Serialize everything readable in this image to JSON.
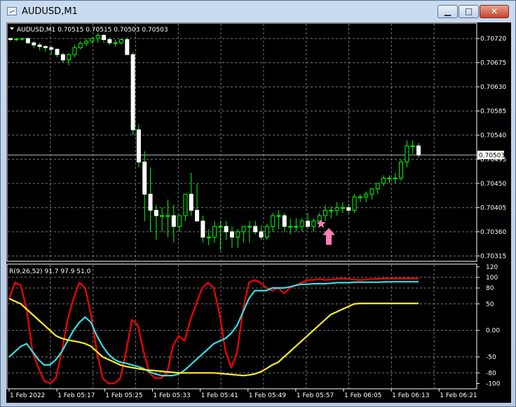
{
  "window": {
    "title": "AUDUSD,M1",
    "minimize": "▁",
    "maximize": "□",
    "close": "✕"
  },
  "chart": {
    "header": "AUDUSD,M1  0.70515 0.70515 0.70503 0.70503",
    "current_price": "0.70503",
    "price_ticks": [
      "0.70720",
      "0.70675",
      "0.70630",
      "0.70585",
      "0.70540",
      "0.70495",
      "0.70450",
      "0.70405",
      "0.70360",
      "0.70315"
    ],
    "time_ticks": [
      "1 Feb 2022",
      "1 Feb 05:17",
      "1 Feb 05:25",
      "1 Feb 05:33",
      "1 Feb 05:41",
      "1 Feb 05:49",
      "1 Feb 05:57",
      "1 Feb 06:05",
      "1 Feb 06:13",
      "1 Feb 06:21"
    ]
  },
  "indicator": {
    "label": "R(9,26,52) 91.7 97.9 51.0",
    "ticks": [
      "120",
      "100",
      "80",
      "50",
      "0.00",
      "-50",
      "-80",
      "-100"
    ]
  },
  "colors": {
    "bull": "#00ff00",
    "bear": "#ffffff",
    "red": "#ff0000",
    "cyan": "#33e0e8",
    "yellow": "#ffee22",
    "grid": "#777777",
    "arrow": "#ff7fb6"
  },
  "chart_data": [
    {
      "type": "candlestick",
      "title": "AUDUSD,M1",
      "x": [
        "05:09",
        "05:10",
        "05:11",
        "05:12",
        "05:13",
        "05:14",
        "05:15",
        "05:16",
        "05:17",
        "05:18",
        "05:19",
        "05:20",
        "05:21",
        "05:22",
        "05:23",
        "05:24",
        "05:25",
        "05:26",
        "05:27",
        "05:28",
        "05:29",
        "05:30",
        "05:31",
        "05:32",
        "05:33",
        "05:34",
        "05:35",
        "05:36",
        "05:37",
        "05:38",
        "05:39",
        "05:40",
        "05:41",
        "05:42",
        "05:43",
        "05:44",
        "05:45",
        "05:46",
        "05:47",
        "05:48",
        "05:49",
        "05:50",
        "05:51",
        "05:52",
        "05:53",
        "05:54",
        "05:55",
        "05:56",
        "05:57",
        "05:58",
        "05:59",
        "06:00",
        "06:01",
        "06:02",
        "06:03",
        "06:04",
        "06:05",
        "06:06",
        "06:07",
        "06:08",
        "06:09",
        "06:10",
        "06:11",
        "06:12",
        "06:13",
        "06:14",
        "06:15",
        "06:16",
        "06:17",
        "06:18",
        "06:19"
      ],
      "open": [
        0.7072,
        0.70718,
        0.70719,
        0.7072,
        0.70712,
        0.70708,
        0.70705,
        0.70703,
        0.707,
        0.7069,
        0.7068,
        0.7069,
        0.70703,
        0.70711,
        0.70715,
        0.7072,
        0.70726,
        0.70718,
        0.70712,
        0.70712,
        0.70718,
        0.7069,
        0.7055,
        0.7049,
        0.7043,
        0.704,
        0.7039,
        0.7039,
        0.7039,
        0.7037,
        0.7039,
        0.7043,
        0.704,
        0.7038,
        0.7035,
        0.7035,
        0.7037,
        0.7037,
        0.7036,
        0.7035,
        0.7036,
        0.7037,
        0.7037,
        0.7036,
        0.7035,
        0.7037,
        0.7039,
        0.7039,
        0.7037,
        0.7037,
        0.7037,
        0.7038,
        0.7037,
        0.7038,
        0.7039,
        0.704,
        0.704,
        0.70405,
        0.70405,
        0.704,
        0.70425,
        0.70425,
        0.7043,
        0.7044,
        0.7045,
        0.7046,
        0.7046,
        0.7046,
        0.7049,
        0.7052,
        0.7052
      ],
      "high": [
        0.70722,
        0.70721,
        0.70721,
        0.70722,
        0.70715,
        0.70712,
        0.70708,
        0.70706,
        0.70702,
        0.70694,
        0.70692,
        0.70708,
        0.70715,
        0.7072,
        0.70722,
        0.7073,
        0.70728,
        0.70722,
        0.70718,
        0.7072,
        0.70722,
        0.70695,
        0.7056,
        0.7051,
        0.7048,
        0.7041,
        0.70405,
        0.7042,
        0.7041,
        0.7039,
        0.7042,
        0.7047,
        0.7045,
        0.7039,
        0.70365,
        0.7038,
        0.7038,
        0.7038,
        0.7037,
        0.70365,
        0.7037,
        0.7038,
        0.7038,
        0.70372,
        0.70375,
        0.70395,
        0.704,
        0.70395,
        0.70385,
        0.70385,
        0.70385,
        0.70395,
        0.70385,
        0.70395,
        0.7041,
        0.70408,
        0.70415,
        0.70415,
        0.70412,
        0.7043,
        0.7043,
        0.70435,
        0.7044,
        0.7045,
        0.70465,
        0.70465,
        0.7047,
        0.70495,
        0.7053,
        0.7053,
        0.70525
      ],
      "low": [
        0.70715,
        0.70715,
        0.70716,
        0.7071,
        0.70702,
        0.70698,
        0.70695,
        0.7069,
        0.70685,
        0.70675,
        0.7067,
        0.70685,
        0.707,
        0.70705,
        0.7071,
        0.70712,
        0.70712,
        0.70708,
        0.70705,
        0.70708,
        0.7069,
        0.7054,
        0.7048,
        0.7038,
        0.7036,
        0.70345,
        0.7036,
        0.7035,
        0.7034,
        0.7036,
        0.7038,
        0.7039,
        0.7038,
        0.7034,
        0.70335,
        0.7034,
        0.70325,
        0.70345,
        0.7033,
        0.7033,
        0.7034,
        0.7034,
        0.70355,
        0.70345,
        0.70345,
        0.7036,
        0.70365,
        0.7036,
        0.70355,
        0.7036,
        0.7036,
        0.70365,
        0.7036,
        0.7037,
        0.7038,
        0.70385,
        0.7039,
        0.70395,
        0.70395,
        0.70395,
        0.70415,
        0.70415,
        0.7042,
        0.7043,
        0.70445,
        0.7045,
        0.7045,
        0.70455,
        0.7048,
        0.70505,
        0.70498
      ],
      "close": [
        0.70718,
        0.70719,
        0.7072,
        0.70712,
        0.70708,
        0.70705,
        0.70703,
        0.707,
        0.7069,
        0.7068,
        0.7069,
        0.70703,
        0.70711,
        0.70715,
        0.7072,
        0.70726,
        0.70718,
        0.70712,
        0.70712,
        0.70718,
        0.7069,
        0.7055,
        0.7049,
        0.7043,
        0.704,
        0.7039,
        0.7039,
        0.7039,
        0.7037,
        0.7039,
        0.7043,
        0.704,
        0.7038,
        0.7035,
        0.7035,
        0.7037,
        0.7037,
        0.7036,
        0.7035,
        0.7036,
        0.7037,
        0.7037,
        0.7036,
        0.7035,
        0.7037,
        0.7039,
        0.7039,
        0.7037,
        0.7037,
        0.7037,
        0.7038,
        0.7037,
        0.7038,
        0.7039,
        0.704,
        0.704,
        0.70405,
        0.70405,
        0.704,
        0.70425,
        0.70425,
        0.7043,
        0.7044,
        0.7045,
        0.7046,
        0.7046,
        0.7046,
        0.7049,
        0.7052,
        0.7052,
        0.70503
      ],
      "marker": {
        "shape": "star + up-arrow",
        "index": 54
      },
      "ylim": [
        0.70305,
        0.7075
      ]
    },
    {
      "type": "line",
      "title": "R(9,26,52) 91.7 97.9 51.0",
      "ylim": [
        -110,
        125
      ],
      "series": [
        {
          "color": "#ff0000",
          "values": [
            60,
            90,
            85,
            40,
            -40,
            -70,
            -95,
            -100,
            -90,
            -40,
            20,
            60,
            90,
            80,
            30,
            -40,
            -90,
            -100,
            -100,
            -90,
            -40,
            20,
            10,
            -40,
            -80,
            -90,
            -90,
            -80,
            -30,
            -10,
            -20,
            20,
            50,
            80,
            90,
            80,
            30,
            -40,
            -70,
            -40,
            40,
            90,
            95,
            90,
            80,
            75,
            80,
            70,
            80,
            85,
            90,
            95,
            95,
            97,
            95,
            96,
            97,
            98,
            97,
            96,
            95,
            96,
            97,
            97,
            98,
            98,
            98,
            98,
            97.9,
            97.9,
            97.9
          ]
        },
        {
          "color": "#33e0e8",
          "values": [
            -50,
            -40,
            -30,
            -25,
            -40,
            -55,
            -65,
            -65,
            -55,
            -40,
            -20,
            0,
            15,
            25,
            15,
            -10,
            -30,
            -45,
            -55,
            -60,
            -62,
            -65,
            -68,
            -72,
            -78,
            -82,
            -85,
            -85,
            -85,
            -82,
            -75,
            -65,
            -55,
            -45,
            -35,
            -25,
            -20,
            -15,
            -5,
            10,
            35,
            60,
            75,
            75,
            75,
            80,
            80,
            80,
            82,
            85,
            87,
            87,
            88,
            88,
            88,
            89,
            90,
            90,
            90,
            91,
            91,
            91,
            91,
            91,
            91.5,
            91.6,
            91.7,
            91.7,
            91.7,
            91.7,
            91.7
          ]
        },
        {
          "color": "#ffee22",
          "values": [
            60,
            55,
            50,
            40,
            30,
            20,
            10,
            0,
            -10,
            -15,
            -18,
            -20,
            -22,
            -25,
            -30,
            -40,
            -50,
            -55,
            -60,
            -65,
            -68,
            -70,
            -72,
            -74,
            -75,
            -76,
            -77,
            -78,
            -79,
            -80,
            -80,
            -80,
            -80,
            -80,
            -80,
            -80,
            -81,
            -82,
            -83,
            -84,
            -85,
            -84,
            -82,
            -78,
            -72,
            -65,
            -60,
            -50,
            -40,
            -30,
            -20,
            -10,
            0,
            10,
            20,
            30,
            35,
            40,
            45,
            50,
            51,
            51,
            51,
            51,
            51,
            51,
            51,
            51,
            51,
            51,
            51
          ]
        }
      ]
    }
  ]
}
